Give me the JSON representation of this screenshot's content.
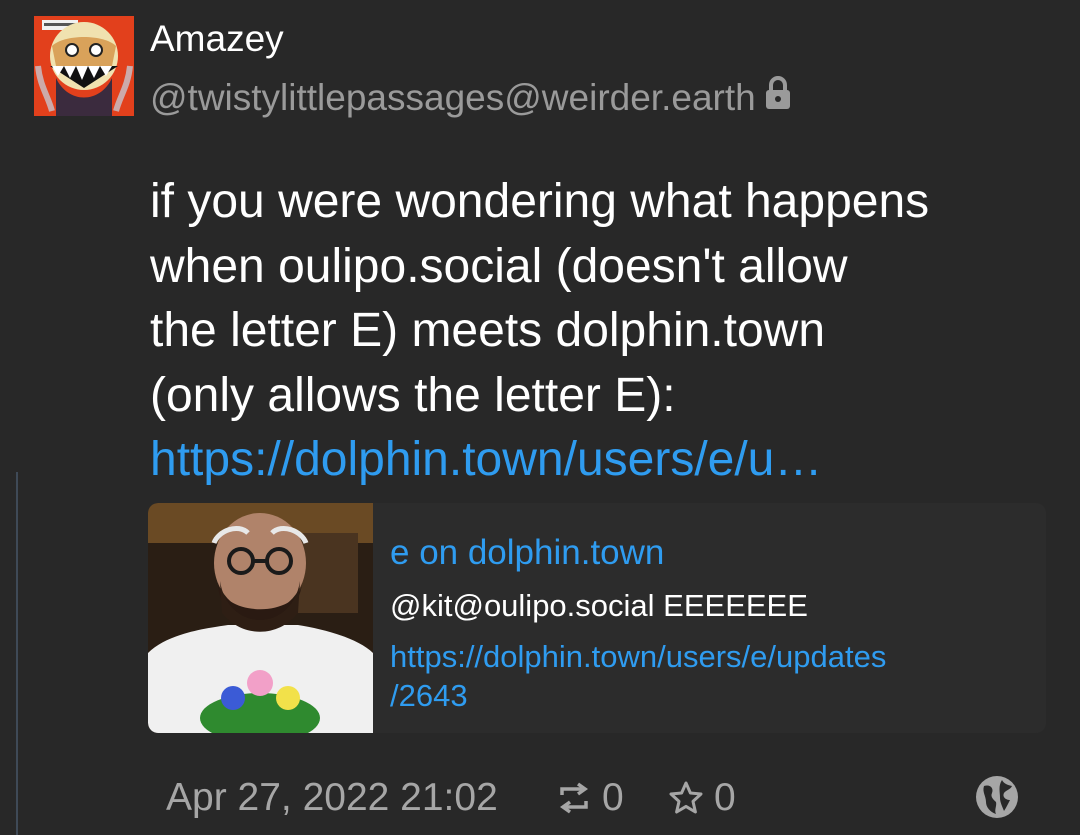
{
  "author": {
    "display_name": "Amazey",
    "handle": "@twistylittlepassages@weirder.earth",
    "avatar_icon": "grinning-monster-avatar",
    "locked_icon": "lock-icon"
  },
  "post": {
    "lines": [
      "if you were wondering what happens",
      "when oulipo.social (doesn't allow",
      "the letter E) meets dolphin.town",
      "(only allows the letter E):"
    ],
    "link_text": "https://dolphin.town/users/e/u…"
  },
  "link_card": {
    "image_icon": "bearded-man-photo",
    "title": "e on dolphin.town",
    "description": "@kit@oulipo.social EEEEEEE",
    "url_lines": [
      "https://dolphin.town/users/e/updates",
      "/2643"
    ]
  },
  "footer": {
    "timestamp": "Apr 27, 2022 21:02",
    "boost_count": "0",
    "favourite_count": "0",
    "boost_icon": "boost-icon",
    "favourite_icon": "star-icon",
    "visibility_icon": "globe-icon"
  },
  "colors": {
    "background": "#282828",
    "link": "#2f9cf0",
    "muted_text": "#a6a6a6",
    "card_background": "#2c2c2c",
    "thread_line": "#3f4a57"
  }
}
